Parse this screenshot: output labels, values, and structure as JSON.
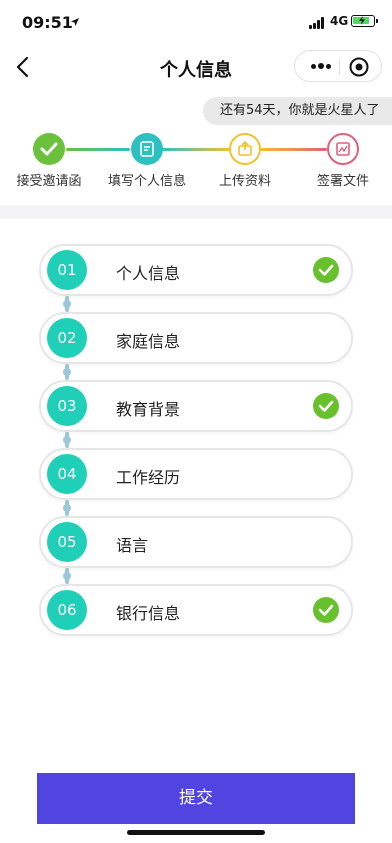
{
  "status_bar": {
    "time": "09:51",
    "network": "4G"
  },
  "nav": {
    "title": "个人信息",
    "back_icon": "chevron-left-icon",
    "more_icon": "more-dots-icon",
    "close_icon": "target-icon"
  },
  "countdown": "还有54天，你就是火星人了",
  "steps": [
    {
      "label": "接受邀请函",
      "color": "#6cc13c",
      "icon": "check-icon",
      "done": true
    },
    {
      "label": "填写个人信息",
      "color": "#2cc0c0",
      "icon": "form-icon",
      "done": true
    },
    {
      "label": "上传资料",
      "color": "#f2c12e",
      "icon": "upload-icon",
      "done": false
    },
    {
      "label": "签署文件",
      "color": "#e0607a",
      "icon": "sign-icon",
      "done": false
    }
  ],
  "sections": [
    {
      "num": "01",
      "label": "个人信息",
      "completed": true
    },
    {
      "num": "02",
      "label": "家庭信息",
      "completed": false
    },
    {
      "num": "03",
      "label": "教育背景",
      "completed": true
    },
    {
      "num": "04",
      "label": "工作经历",
      "completed": false
    },
    {
      "num": "05",
      "label": "语言",
      "completed": false
    },
    {
      "num": "06",
      "label": "银行信息",
      "completed": true
    }
  ],
  "submit_label": "提交",
  "colors": {
    "accent": "#5244e0",
    "teal": "#1fcfb8",
    "check_green": "#67c12d"
  }
}
